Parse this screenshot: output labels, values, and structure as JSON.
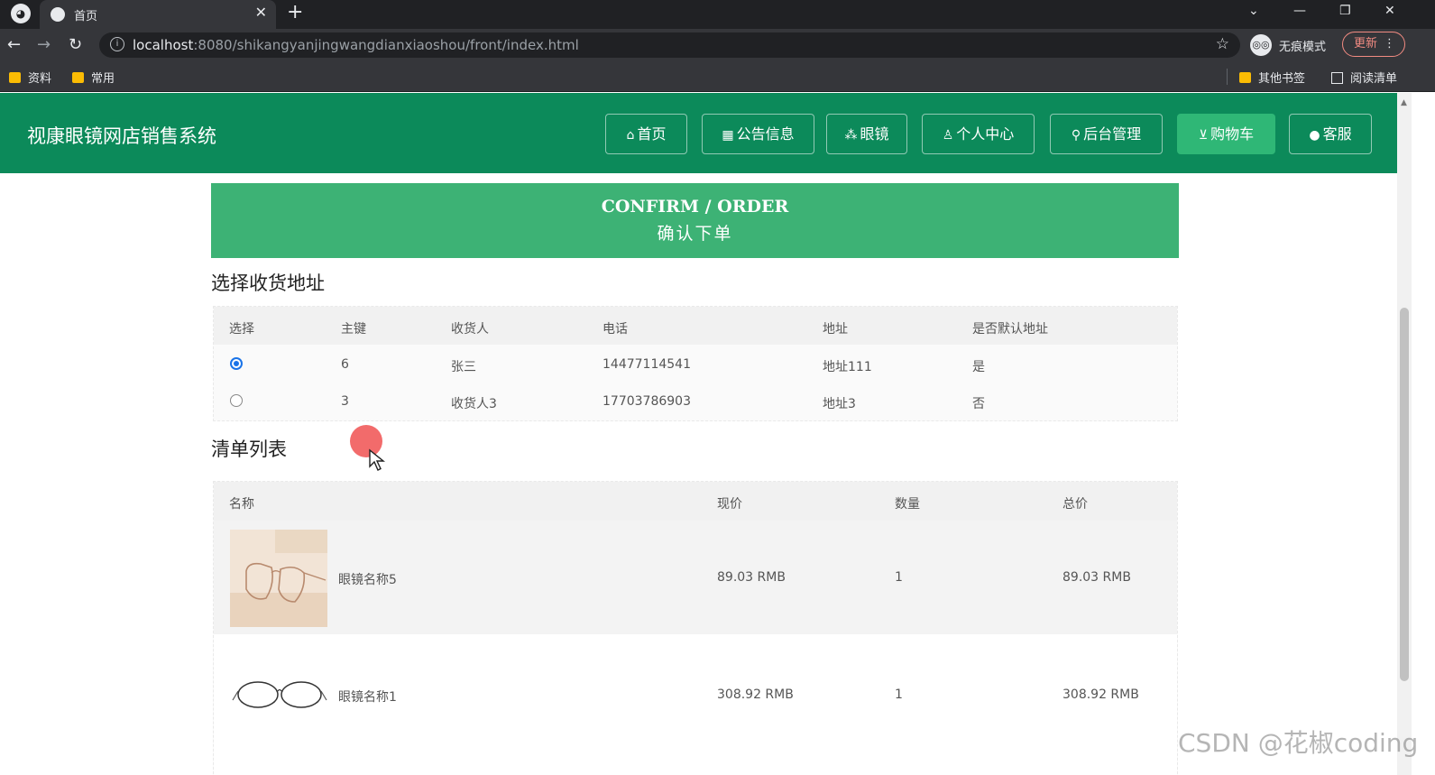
{
  "browser": {
    "tab_title": "首页",
    "url_host": "localhost",
    "url_rest": ":8080/shikangyanjingwangdianxiaoshou/front/index.html",
    "incognito_label": "无痕模式",
    "update_label": "更新",
    "bookmarks": [
      "资料",
      "常用"
    ],
    "bookmarks_right": [
      "其他书签",
      "阅读清单"
    ]
  },
  "app": {
    "title": "视康眼镜网店销售系统",
    "nav": [
      {
        "icon": "⌂",
        "label": "首页"
      },
      {
        "icon": "▦",
        "label": "公告信息"
      },
      {
        "icon": "⁂",
        "label": "眼镜"
      },
      {
        "icon": "♙",
        "label": "个人中心"
      },
      {
        "icon": "⚲",
        "label": "后台管理"
      },
      {
        "icon": "⊻",
        "label": "购物车"
      },
      {
        "icon": "●",
        "label": "客服"
      }
    ],
    "active_nav": "购物车"
  },
  "banner": {
    "en": "CONFIRM / ORDER",
    "cn": "确认下单"
  },
  "address_section": {
    "title": "选择收货地址",
    "headers": [
      "选择",
      "主键",
      "收货人",
      "电话",
      "地址",
      "是否默认地址"
    ],
    "rows": [
      {
        "selected": true,
        "id": "6",
        "receiver": "张三",
        "phone": "14477114541",
        "address": "地址111",
        "is_default": "是"
      },
      {
        "selected": false,
        "id": "3",
        "receiver": "收货人3",
        "phone": "17703786903",
        "address": "地址3",
        "is_default": "否"
      }
    ]
  },
  "order_section": {
    "title": "清单列表",
    "headers": [
      "名称",
      "现价",
      "数量",
      "总价"
    ],
    "rows": [
      {
        "name": "眼镜名称5",
        "price": "89.03 RMB",
        "qty": "1",
        "total": "89.03 RMB",
        "image": "glasses-photo"
      },
      {
        "name": "眼镜名称1",
        "price": "308.92 RMB",
        "qty": "1",
        "total": "308.92 RMB",
        "image": "glasses-outline"
      }
    ]
  },
  "watermark": "CSDN @花椒coding",
  "colors": {
    "header_green": "#0c8a5a",
    "banner_green": "#3db275",
    "active_nav": "#2fb776"
  }
}
